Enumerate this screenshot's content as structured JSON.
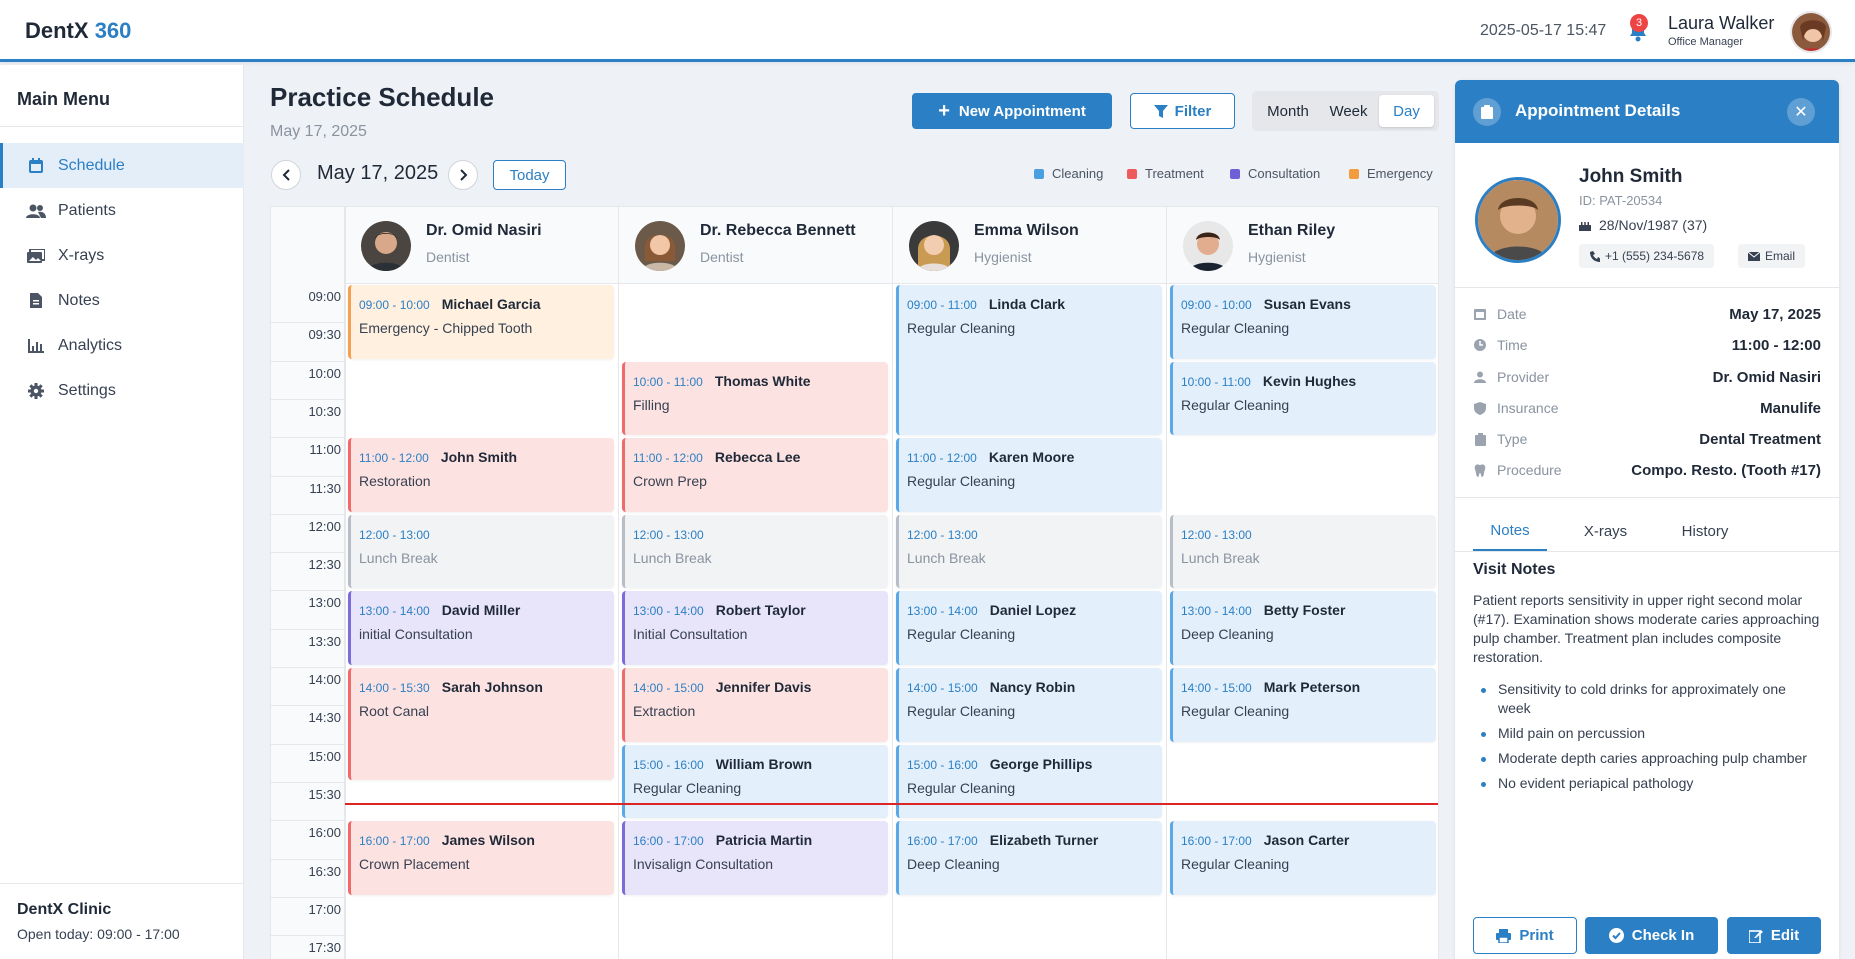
{
  "app": {
    "logo_main": "DentX",
    "logo_accent": "360"
  },
  "header": {
    "datetime": "2025-05-17 15:47",
    "notification_count": "3",
    "user_name": "Laura Walker",
    "user_role": "Office Manager"
  },
  "sidebar": {
    "title": "Main Menu",
    "items": [
      {
        "label": "Schedule",
        "icon": "calendar-icon",
        "active": true
      },
      {
        "label": "Patients",
        "icon": "users-icon"
      },
      {
        "label": "X-rays",
        "icon": "images-icon"
      },
      {
        "label": "Notes",
        "icon": "file-icon"
      },
      {
        "label": "Analytics",
        "icon": "chart-icon"
      },
      {
        "label": "Settings",
        "icon": "gear-icon"
      }
    ],
    "clinic_name": "DentX Clinic",
    "clinic_hours": "Open today: 09:00 - 17:00"
  },
  "page": {
    "title": "Practice Schedule",
    "subtitle": "May 17, 2025",
    "new_appointment": "New Appointment",
    "filter": "Filter",
    "views": [
      "Month",
      "Week",
      "Day"
    ],
    "active_view": "Day",
    "current_date": "May 17, 2025",
    "today": "Today"
  },
  "legend": [
    {
      "label": "Cleaning",
      "color": "#4a9fe0"
    },
    {
      "label": "Treatment",
      "color": "#ef5b5b"
    },
    {
      "label": "Consultation",
      "color": "#7060d8"
    },
    {
      "label": "Emergency",
      "color": "#f39b3f"
    }
  ],
  "times": [
    "09:00",
    "09:30",
    "10:00",
    "10:30",
    "11:00",
    "11:30",
    "12:00",
    "12:30",
    "13:00",
    "13:30",
    "14:00",
    "14:30",
    "15:00",
    "15:30",
    "16:00",
    "16:30",
    "17:00",
    "17:30"
  ],
  "providers": [
    {
      "name": "Dr. Omid Nasiri",
      "role": "Dentist"
    },
    {
      "name": "Dr. Rebecca Bennett",
      "role": "Dentist"
    },
    {
      "name": "Emma Wilson",
      "role": "Hygienist"
    },
    {
      "name": "Ethan Riley",
      "role": "Hygienist"
    }
  ],
  "appointments": [
    [
      {
        "time": "09:00 - 10:00",
        "patient": "Michael Garcia",
        "procedure": "Emergency - Chipped Tooth",
        "type": "emergency"
      },
      {
        "time": "11:00 - 12:00",
        "patient": "John Smith",
        "procedure": "Restoration",
        "type": "treatment"
      },
      {
        "time": "12:00 - 13:00",
        "patient": "",
        "procedure": "Lunch Break",
        "type": "break"
      },
      {
        "time": "13:00 - 14:00",
        "patient": "David Miller",
        "procedure": "initial Consultation",
        "type": "consult"
      },
      {
        "time": "14:00 - 15:30",
        "patient": "Sarah Johnson",
        "procedure": "Root Canal",
        "type": "treatment"
      },
      {
        "time": "16:00 - 17:00",
        "patient": "James Wilson",
        "procedure": "Crown Placement",
        "type": "treatment"
      }
    ],
    [
      {
        "time": "10:00 - 11:00",
        "patient": "Thomas White",
        "procedure": "Filling",
        "type": "treatment"
      },
      {
        "time": "11:00 - 12:00",
        "patient": "Rebecca Lee",
        "procedure": "Crown Prep",
        "type": "treatment"
      },
      {
        "time": "12:00 - 13:00",
        "patient": "",
        "procedure": "Lunch Break",
        "type": "break"
      },
      {
        "time": "13:00 - 14:00",
        "patient": "Robert Taylor",
        "procedure": "Initial Consultation",
        "type": "consult"
      },
      {
        "time": "14:00 - 15:00",
        "patient": "Jennifer Davis",
        "procedure": "Extraction",
        "type": "treatment"
      },
      {
        "time": "15:00 - 16:00",
        "patient": "William Brown",
        "procedure": "Regular Cleaning",
        "type": "cleaning"
      },
      {
        "time": "16:00 - 17:00",
        "patient": "Patricia Martin",
        "procedure": "Invisalign Consultation",
        "type": "consult"
      }
    ],
    [
      {
        "time": "09:00 - 11:00",
        "patient": "Linda Clark",
        "procedure": "Regular Cleaning",
        "type": "cleaning"
      },
      {
        "time": "11:00 - 12:00",
        "patient": "Karen Moore",
        "procedure": "Regular Cleaning",
        "type": "cleaning"
      },
      {
        "time": "12:00 - 13:00",
        "patient": "",
        "procedure": "Lunch Break",
        "type": "break"
      },
      {
        "time": "13:00 - 14:00",
        "patient": "Daniel Lopez",
        "procedure": "Regular Cleaning",
        "type": "cleaning"
      },
      {
        "time": "14:00 - 15:00",
        "patient": "Nancy Robin",
        "procedure": "Regular Cleaning",
        "type": "cleaning"
      },
      {
        "time": "15:00 - 16:00",
        "patient": "George Phillips",
        "procedure": "Regular Cleaning",
        "type": "cleaning"
      },
      {
        "time": "16:00 - 17:00",
        "patient": "Elizabeth Turner",
        "procedure": "Deep Cleaning",
        "type": "cleaning"
      }
    ],
    [
      {
        "time": "09:00 - 10:00",
        "patient": "Susan Evans",
        "procedure": "Regular Cleaning",
        "type": "cleaning"
      },
      {
        "time": "10:00 - 11:00",
        "patient": "Kevin Hughes",
        "procedure": "Regular Cleaning",
        "type": "cleaning"
      },
      {
        "time": "12:00 - 13:00",
        "patient": "",
        "procedure": "Lunch Break",
        "type": "break"
      },
      {
        "time": "13:00 - 14:00",
        "patient": "Betty Foster",
        "procedure": "Deep Cleaning",
        "type": "cleaning"
      },
      {
        "time": "14:00 - 15:00",
        "patient": "Mark Peterson",
        "procedure": "Regular Cleaning",
        "type": "cleaning"
      },
      {
        "time": "16:00 - 17:00",
        "patient": "Jason Carter",
        "procedure": "Regular Cleaning",
        "type": "cleaning"
      }
    ]
  ],
  "details": {
    "title": "Appointment Details",
    "patient_name": "John Smith",
    "patient_id": "ID: PAT-20534",
    "dob": "28/Nov/1987 (37)",
    "phone": "+1 (555) 234-5678",
    "email_label": "Email",
    "rows": [
      {
        "label": "Date",
        "value": "May 17, 2025",
        "icon": "calendar-icon"
      },
      {
        "label": "Time",
        "value": "11:00 - 12:00",
        "icon": "clock-icon"
      },
      {
        "label": "Provider",
        "value": "Dr. Omid Nasiri",
        "icon": "user-icon"
      },
      {
        "label": "Insurance",
        "value": "Manulife",
        "icon": "shield-icon"
      },
      {
        "label": "Type",
        "value": "Dental Treatment",
        "icon": "clipboard-icon"
      },
      {
        "label": "Procedure",
        "value": "Compo. Resto. (Tooth #17)",
        "icon": "tooth-icon"
      }
    ],
    "tabs": [
      "Notes",
      "X-rays",
      "History"
    ],
    "notes_title": "Visit Notes",
    "notes_text": "Patient reports sensitivity in upper right second molar (#17). Examination shows moderate caries approaching pulp chamber. Treatment plan includes composite restoration.",
    "notes_list": [
      "Sensitivity to cold drinks for approximately one week",
      "Mild pain on percussion",
      "Moderate depth caries approaching pulp chamber",
      "No evident periapical pathology"
    ],
    "print": "Print",
    "check_in": "Check In",
    "edit": "Edit"
  }
}
